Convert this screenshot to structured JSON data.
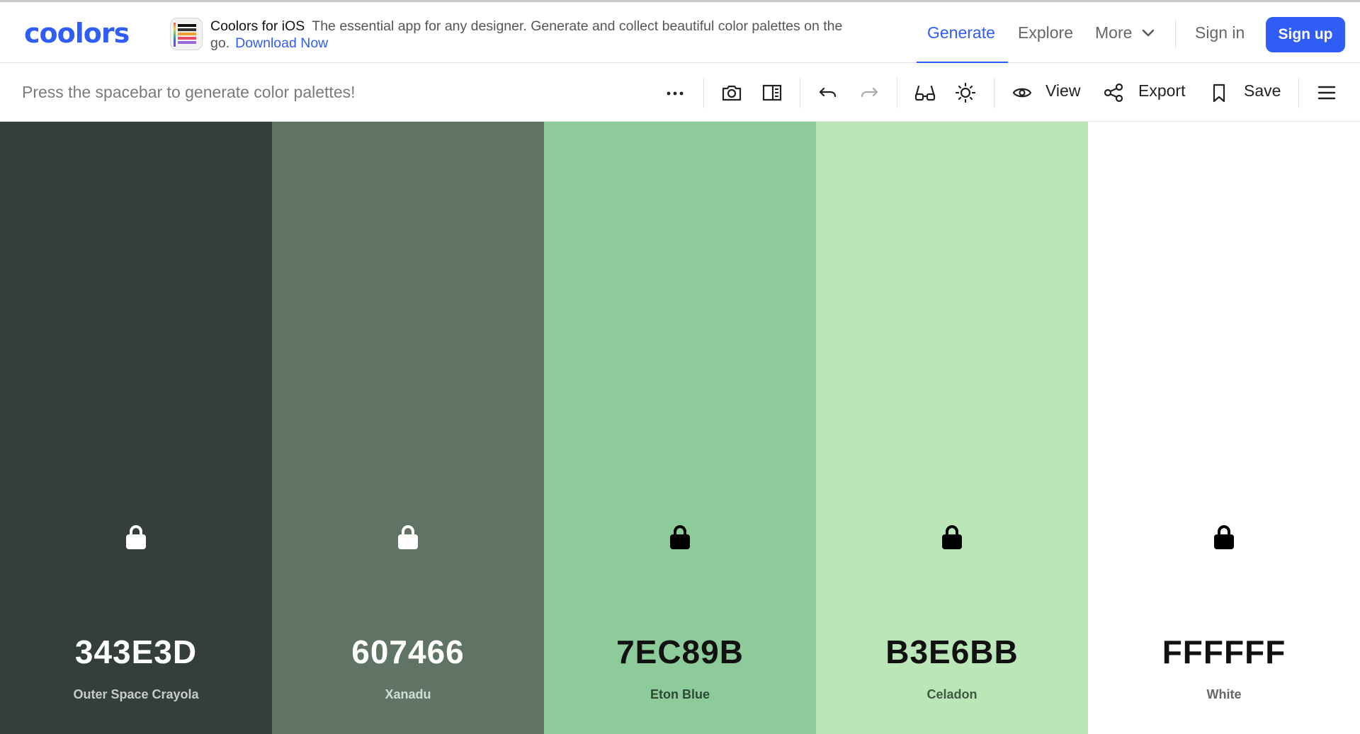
{
  "brand": {
    "logo_text": "coolors",
    "accent": "#2f5df5"
  },
  "promo": {
    "title": "Coolors for iOS",
    "text": "The essential app for any designer. Generate and collect beautiful color palettes on the go.",
    "link": "Download Now"
  },
  "nav": {
    "generate": "Generate",
    "explore": "Explore",
    "more": "More",
    "sign_in": "Sign in",
    "sign_up": "Sign up"
  },
  "toolbar": {
    "hint": "Press the spacebar to generate color palettes!",
    "view": "View",
    "export": "Export",
    "save": "Save",
    "icons": [
      "more-options-icon",
      "camera-icon",
      "side-panel-icon",
      "undo-icon",
      "redo-icon",
      "glasses-icon",
      "brightness-icon",
      "eye-icon",
      "share-icon",
      "bookmark-icon",
      "menu-icon"
    ]
  },
  "palette": [
    {
      "hex": "343E3D",
      "name": "Outer Space Crayola",
      "color": "#343E3D",
      "text_color": "#ffffff",
      "name_color": "#c7cccb",
      "lock_color": "#ffffff"
    },
    {
      "hex": "607466",
      "name": "Xanadu",
      "color": "#607466",
      "text_color": "#ffffff",
      "name_color": "#d3dbd5",
      "lock_color": "#ffffff"
    },
    {
      "hex": "7EC89B",
      "name": "Eton Blue",
      "color": "#8DCB9A",
      "text_color": "#111111",
      "name_color": "#2e4a36",
      "lock_color": "#000000"
    },
    {
      "hex": "B3E6BB",
      "name": "Celadon",
      "color": "#BBE6B8",
      "text_color": "#111111",
      "name_color": "#3f5a41",
      "lock_color": "#000000"
    },
    {
      "hex": "FFFFFF",
      "name": "White",
      "color": "#FFFFFF",
      "text_color": "#111111",
      "name_color": "#666666",
      "lock_color": "#000000"
    }
  ]
}
